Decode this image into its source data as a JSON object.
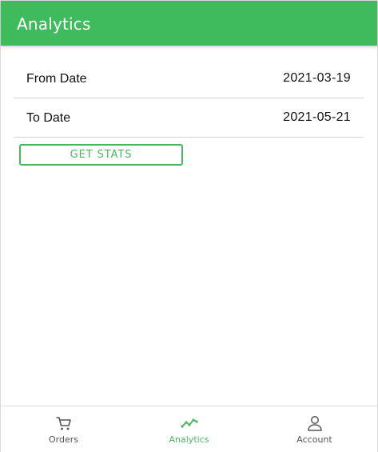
{
  "header": {
    "title": "Analytics"
  },
  "filters": {
    "from_label": "From Date",
    "from_value": "2021-03-19",
    "to_label": "To Date",
    "to_value": "2021-05-21",
    "button_label": "GET STATS"
  },
  "bottom_nav": {
    "items": [
      {
        "label": "Orders",
        "icon": "cart-icon",
        "active": false
      },
      {
        "label": "Analytics",
        "icon": "trend-line-icon",
        "active": true
      },
      {
        "label": "Account",
        "icon": "user-icon",
        "active": false
      }
    ]
  },
  "colors": {
    "header": "#3fbb5d",
    "accent": "#47b85f",
    "inactive_nav": "#555555"
  }
}
